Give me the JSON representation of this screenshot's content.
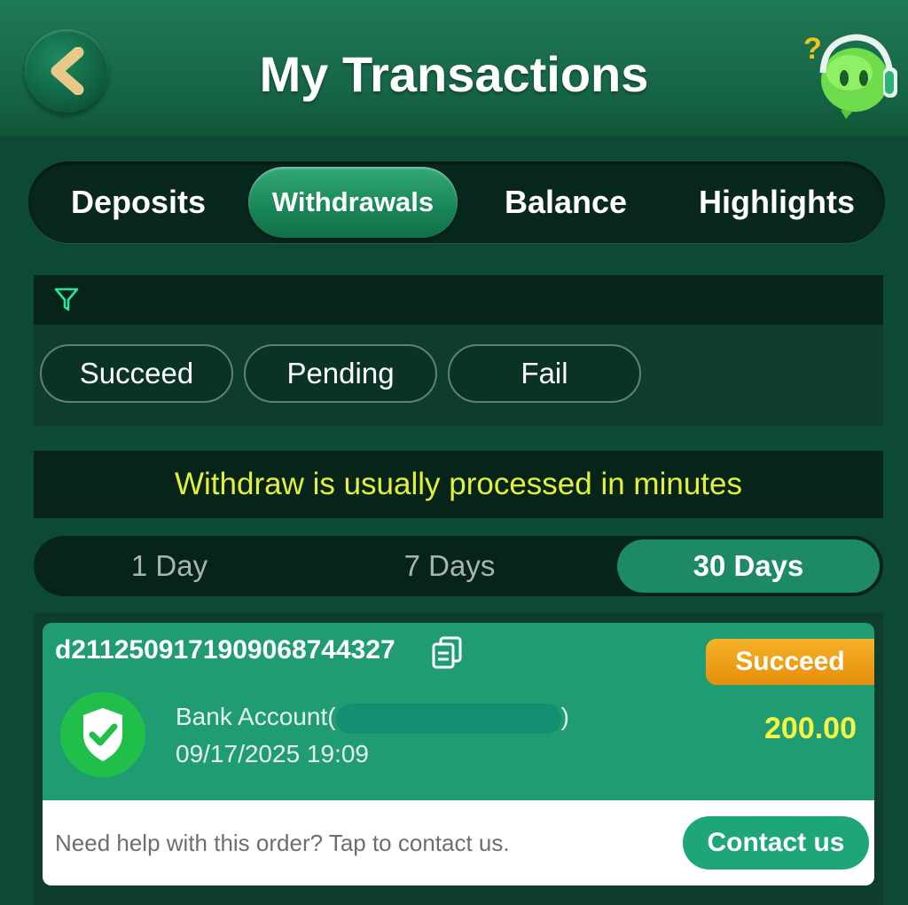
{
  "header": {
    "title": "My Transactions",
    "back_icon": "chevron-left-icon",
    "help_icon": "support-mascot-icon"
  },
  "tabs": [
    {
      "label": "Deposits",
      "active": false
    },
    {
      "label": "Withdrawals",
      "active": true
    },
    {
      "label": "Balance",
      "active": false
    },
    {
      "label": "Highlights",
      "active": false
    }
  ],
  "filter": {
    "icon": "filter-icon",
    "options": [
      {
        "label": "Succeed"
      },
      {
        "label": "Pending"
      },
      {
        "label": "Fail"
      }
    ]
  },
  "notice": "Withdraw is usually processed in minutes",
  "ranges": [
    {
      "label": "1 Day",
      "active": false
    },
    {
      "label": "7 Days",
      "active": false
    },
    {
      "label": "30 Days",
      "active": true
    }
  ],
  "transaction": {
    "order_id": "d2112509171909068744327",
    "status": "Succeed",
    "account_prefix": "Bank Account(",
    "account_suffix": ")",
    "datetime": "09/17/2025 19:09",
    "amount": "200.00",
    "help_text": "Need help with this order? Tap to contact us.",
    "contact_label": "Contact us"
  },
  "colors": {
    "background": "#0c4a36",
    "accent": "#1ea67a",
    "notice_text": "#e4f03a",
    "status_badge": "#f0a01a",
    "amount": "#f4f544"
  }
}
